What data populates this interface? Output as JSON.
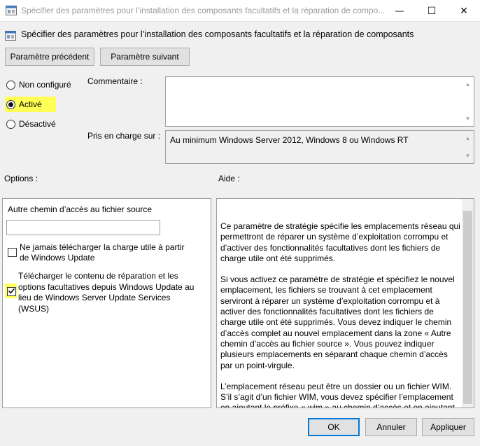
{
  "window": {
    "title": "Spécifier des paramètres pour l’installation des composants facultatifs et la réparation de compo...",
    "minimize_glyph": "—",
    "maximize_glyph": "☐",
    "close_glyph": "✕"
  },
  "header": {
    "text": "Spécifier des paramètres pour l’installation des composants facultatifs et la réparation de composants"
  },
  "nav": {
    "previous_label": "Paramètre précédent",
    "next_label": "Paramètre suivant"
  },
  "state": {
    "not_configured": "Non configuré",
    "enabled": "Activé",
    "disabled": "Désactivé",
    "selected": "enabled"
  },
  "comment": {
    "label": "Commentaire :",
    "value": ""
  },
  "supported": {
    "label": "Pris en charge sur :",
    "value": "Au minimum Windows Server 2012, Windows 8 ou Windows RT"
  },
  "options": {
    "label": "Options :",
    "source_path_label": "Autre chemin d’accès au fichier source",
    "source_path_value": "",
    "never_download_label": "Ne jamais télécharger la charge utile à partir de Windows Update",
    "never_download_checked": false,
    "download_repair_label": "Télécharger le contenu de réparation et les options facultatives depuis Windows Update au lieu de Windows Server Update Services (WSUS)",
    "download_repair_checked": true
  },
  "help": {
    "label": "Aide :",
    "paragraphs": [
      "Ce paramètre de stratégie spécifie les emplacements réseau qui permettront de réparer un système d’exploitation corrompu et d’activer des fonctionnalités facultatives dont les fichiers de charge utile ont été supprimés.",
      "Si vous activez ce paramètre de stratégie et spécifiez le nouvel emplacement, les fichiers se trouvant à cet emplacement serviront à réparer un système d’exploitation corrompu et à activer des fonctionnalités facultatives dont les fichiers de charge utile ont été supprimés. Vous devez indiquer le chemin d’accès complet au nouvel emplacement dans la zone « Autre chemin d’accès au fichier source ». Vous pouvez indiquer plusieurs emplacements en séparant chaque chemin d’accès par un point-virgule.",
      "L’emplacement réseau peut être un dossier ou un fichier WIM. S’il s’agit d’un fichier WIM, vous devez spécifier l’emplacement en ajoutant le préfixe « wim » au chemin d’accès et en ajoutant"
    ]
  },
  "footer": {
    "ok_label": "OK",
    "cancel_label": "Annuler",
    "apply_label": "Appliquer"
  },
  "colors": {
    "highlight": "#ffff55",
    "accent_border": "#0078d7"
  }
}
